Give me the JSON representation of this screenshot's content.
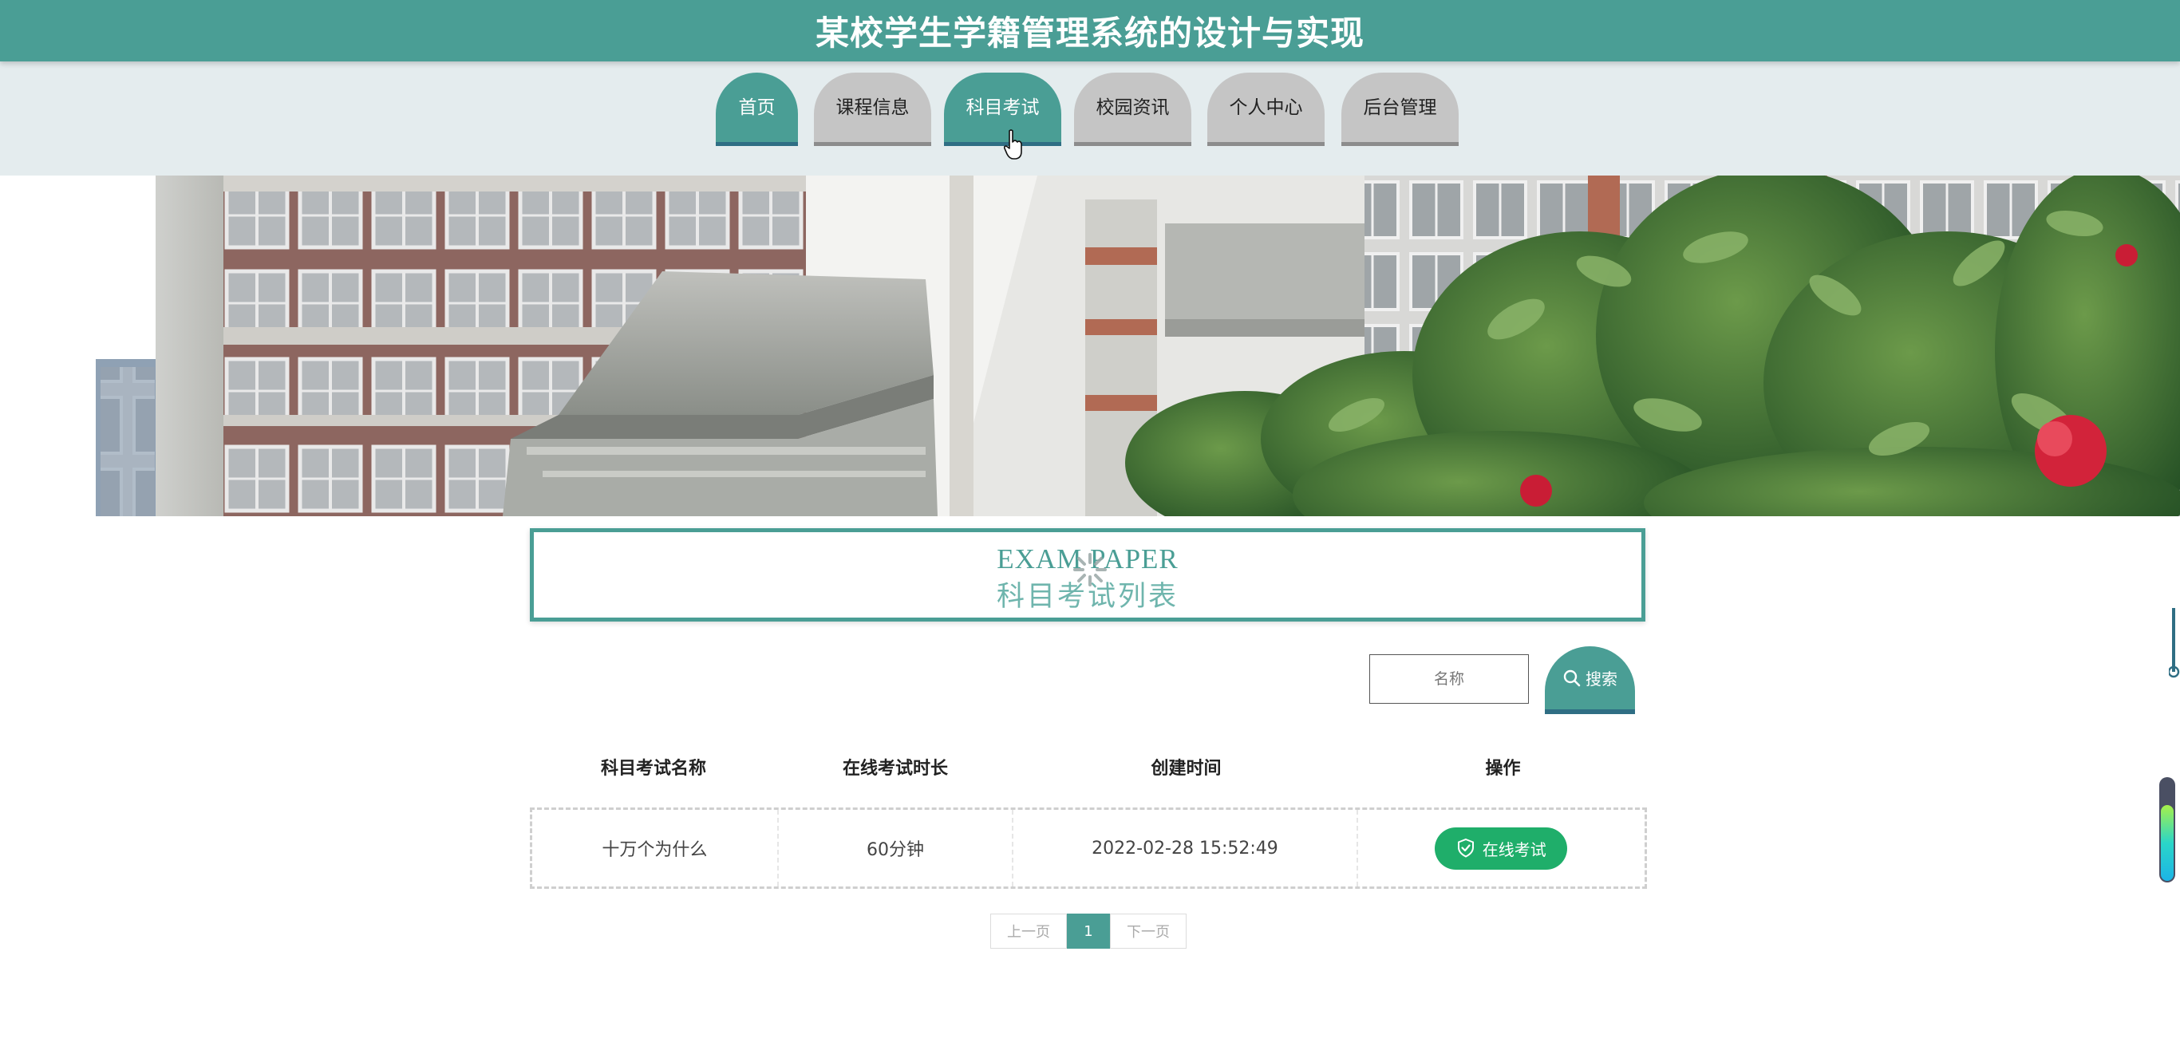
{
  "header": {
    "title": "某校学生学籍管理系统的设计与实现"
  },
  "nav": {
    "active": "科目考试",
    "items": [
      {
        "label": "首页"
      },
      {
        "label": "课程信息"
      },
      {
        "label": "科目考试"
      },
      {
        "label": "校园资讯"
      },
      {
        "label": "个人中心"
      },
      {
        "label": "后台管理"
      }
    ]
  },
  "section": {
    "title_en": "EXAM PAPER",
    "title_zh": "科目考试列表"
  },
  "search": {
    "placeholder": "名称",
    "button_label": "搜索"
  },
  "table": {
    "headers": [
      "科目考试名称",
      "在线考试时长",
      "创建时间",
      "操作"
    ],
    "rows": [
      {
        "name": "十万个为什么",
        "duration": "60分钟",
        "created": "2022-02-28 15:52:49",
        "action": "在线考试"
      }
    ]
  },
  "pagination": {
    "prev": "上一页",
    "current": "1",
    "next": "下一页"
  },
  "progress_widget": {
    "fill_fraction": 0.72
  },
  "colors": {
    "primary": "#4a9e95",
    "primary_dark": "#2f6e84",
    "nav_inactive": "#c5c5c5",
    "exam_button": "#1fae6a"
  }
}
